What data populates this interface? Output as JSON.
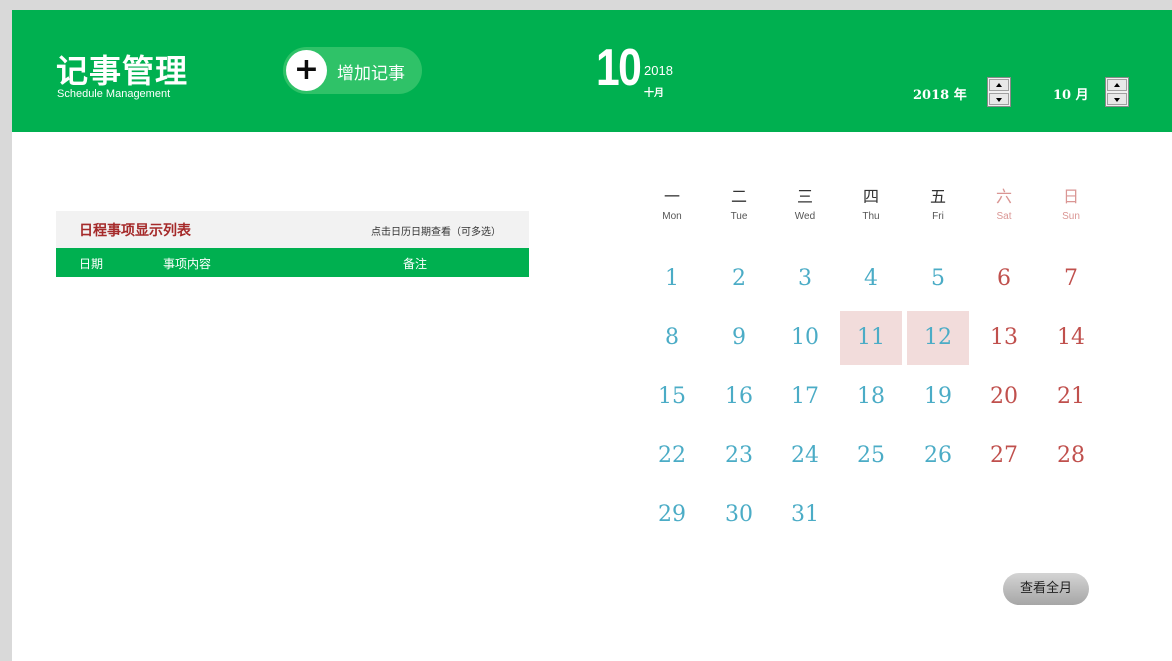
{
  "header": {
    "title": "记事管理",
    "subtitle": "Schedule Management",
    "add_button_label": "增加记事",
    "add_button_icon": "plus-icon",
    "current_month_number": "10",
    "current_year": "2018",
    "current_month_cn": "十月",
    "year_selector": {
      "value": "2018 年"
    },
    "month_selector": {
      "value": "10 月"
    }
  },
  "list_panel": {
    "title": "日程事项显示列表",
    "hint": "点击日历日期查看（可多选）",
    "columns": [
      "日期",
      "事项内容",
      "备注"
    ]
  },
  "calendar": {
    "weekdays": [
      {
        "cn": "一",
        "en": "Mon"
      },
      {
        "cn": "二",
        "en": "Tue"
      },
      {
        "cn": "三",
        "en": "Wed"
      },
      {
        "cn": "四",
        "en": "Thu"
      },
      {
        "cn": "五",
        "en": "Fri"
      },
      {
        "cn": "六",
        "en": "Sat"
      },
      {
        "cn": "日",
        "en": "Sun"
      }
    ],
    "weeks": [
      [
        "1",
        "2",
        "3",
        "4",
        "5",
        "6",
        "7"
      ],
      [
        "8",
        "9",
        "10",
        "11",
        "12",
        "13",
        "14"
      ],
      [
        "15",
        "16",
        "17",
        "18",
        "19",
        "20",
        "21"
      ],
      [
        "22",
        "23",
        "24",
        "25",
        "26",
        "27",
        "28"
      ],
      [
        "29",
        "30",
        "31",
        "",
        "",
        "",
        ""
      ]
    ],
    "highlighted_days": [
      "11",
      "12"
    ],
    "view_month_button": "查看全月"
  },
  "colors": {
    "brand_green": "#00b050",
    "weekday_blue": "#4bacc6",
    "weekend_red": "#c0504d",
    "weekend_header": "#da9694",
    "highlight_bg": "#f2dcdb",
    "list_title": "#a52a2a"
  }
}
